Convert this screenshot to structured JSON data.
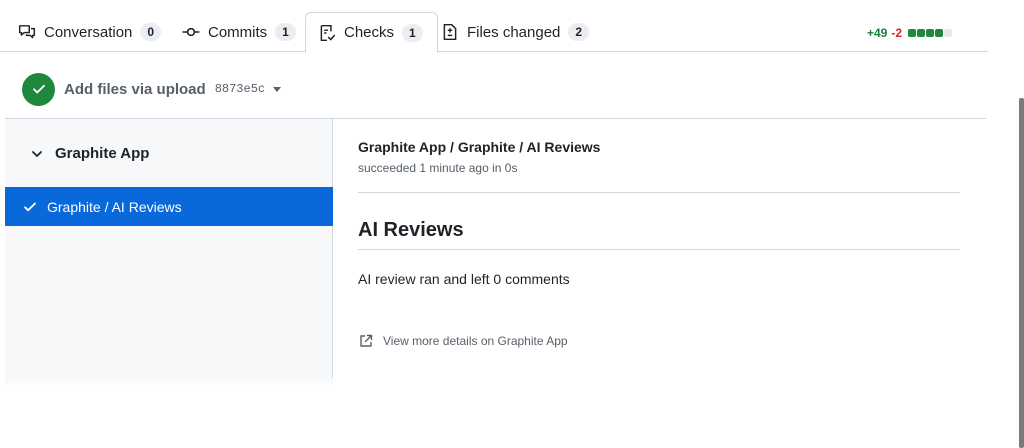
{
  "tabs": [
    {
      "label": "Conversation",
      "count": "0",
      "icon": "comment-discussion-icon"
    },
    {
      "label": "Commits",
      "count": "1",
      "icon": "git-commit-icon"
    },
    {
      "label": "Checks",
      "count": "1",
      "icon": "checklist-icon",
      "selected": true
    },
    {
      "label": "Files changed",
      "count": "2",
      "icon": "file-diff-icon"
    }
  ],
  "diffstat": {
    "additions": "+49",
    "deletions": "-2",
    "blocks": [
      "green",
      "green",
      "green",
      "green",
      "gray"
    ]
  },
  "commit": {
    "title": "Add files via upload",
    "sha": "8873e5c",
    "status": "success"
  },
  "sidebar": {
    "app_name": "Graphite App",
    "checks": [
      {
        "label": "Graphite / AI Reviews",
        "status": "success",
        "selected": true
      }
    ]
  },
  "run": {
    "title": "Graphite App / Graphite / AI Reviews",
    "meta": "succeeded 1 minute ago in 0s",
    "heading": "AI Reviews",
    "body": "AI review ran and left 0 comments",
    "details_link": "View more details on Graphite App"
  },
  "colors": {
    "accent_blue": "#0969da",
    "success_green": "#1f883d",
    "diff_add": "#1a7f37",
    "diff_del": "#d1242f"
  }
}
